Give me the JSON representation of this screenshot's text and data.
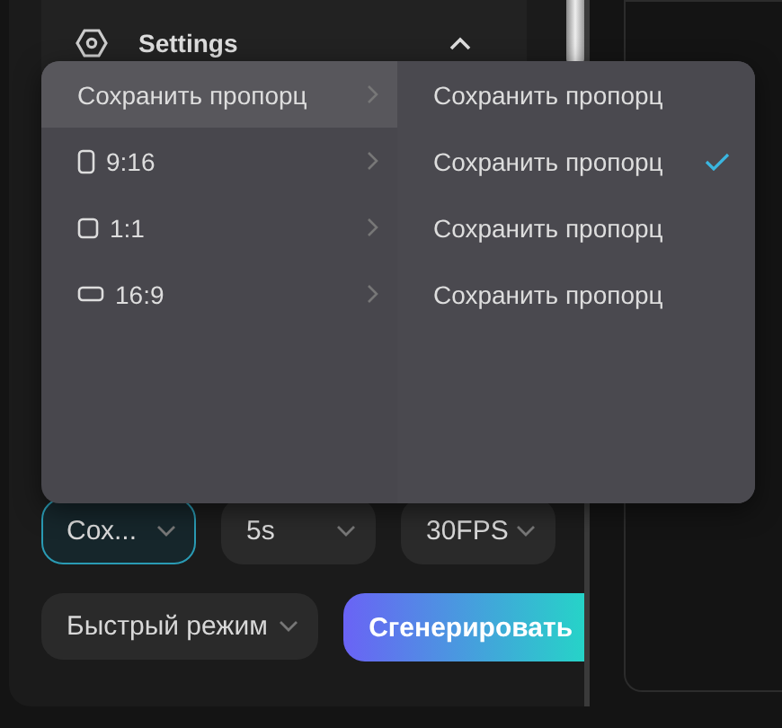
{
  "settings": {
    "title": "Settings",
    "expanded": true
  },
  "menu": {
    "left": [
      {
        "label": "Сохранить пропорц",
        "kind": "none",
        "selected": true
      },
      {
        "label": "9:16",
        "kind": "portrait",
        "selected": false
      },
      {
        "label": "1:1",
        "kind": "square",
        "selected": false
      },
      {
        "label": "16:9",
        "kind": "landscape",
        "selected": false
      }
    ],
    "right": [
      {
        "label": "Сохранить пропорц",
        "checked": false
      },
      {
        "label": "Сохранить пропорц",
        "checked": true
      },
      {
        "label": "Сохранить пропорц",
        "checked": false
      },
      {
        "label": "Сохранить пропорц",
        "checked": false
      }
    ]
  },
  "selects": [
    {
      "value": "Сох...",
      "focused": true
    },
    {
      "value": "5s",
      "focused": false
    },
    {
      "value": "30FPS",
      "focused": false
    }
  ],
  "mode": {
    "value": "Быстрый режим"
  },
  "generate_button": "Сгенерировать"
}
